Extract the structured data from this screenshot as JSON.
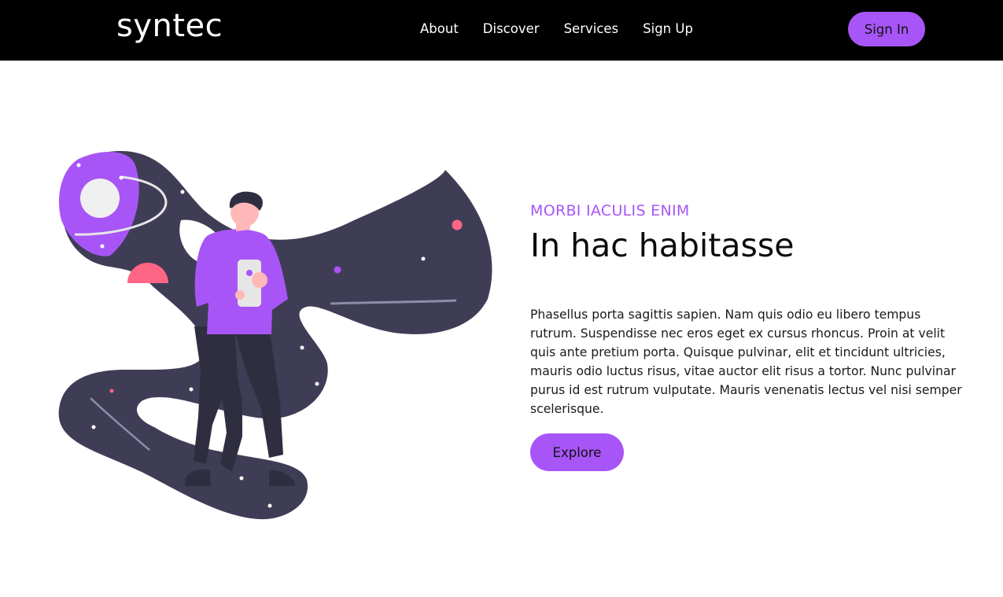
{
  "nav": {
    "logo": "syntec",
    "links": [
      {
        "label": "About"
      },
      {
        "label": "Discover"
      },
      {
        "label": "Services"
      },
      {
        "label": "Sign Up"
      }
    ],
    "signin_label": "Sign In"
  },
  "hero": {
    "eyebrow": "MORBI IACULIS ENIM",
    "headline": "In hac habitasse",
    "body": "Phasellus porta sagittis sapien. Nam quis odio eu libero tempus rutrum. Suspendisse nec eros eget ex cursus rhoncus. Proin at velit quis ante pretium porta. Quisque pulvinar, elit et tincidunt ultricies, mauris odio luctus risus, vitae auctor elit risus a tortor. Nunc pulvinar purus id est rutrum vulputate. Mauris venenatis lectus vel nisi semper scelerisque.",
    "cta_label": "Explore"
  },
  "colors": {
    "accent": "#a855f7",
    "navbar_bg": "#000000",
    "space_dark": "#3f3d56",
    "planet_pink": "#ff6584"
  },
  "illustration": {
    "icon": "person-with-phone-in-space-illustration"
  }
}
